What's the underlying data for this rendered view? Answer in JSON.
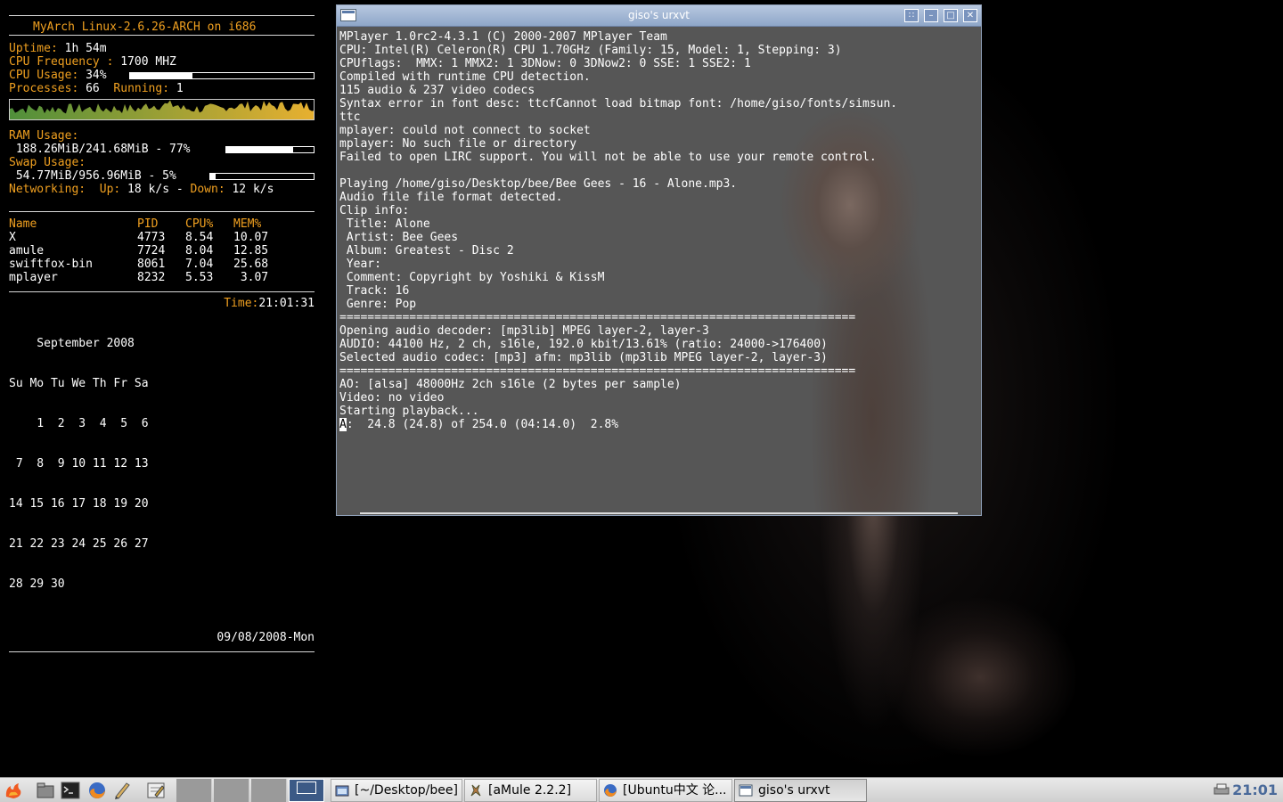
{
  "conky": {
    "header": "MyArch Linux-2.6.26-ARCH on i686",
    "uptime_label": "Uptime:",
    "uptime_value": " 1h 54m",
    "cpu_freq_label": "CPU Frequency :",
    "cpu_freq_value": " 1700 MHZ",
    "cpu_usage_label": "CPU Usage:",
    "cpu_usage_value": " 34%",
    "cpu_usage_fraction": 0.34,
    "processes_label": "Processes:",
    "processes_value": " 66  ",
    "running_label": "Running:",
    "running_value": " 1",
    "ram_label": "RAM Usage:",
    "ram_value": " 188.26MiB/241.68MiB - 77%",
    "ram_fraction": 0.77,
    "swap_label": "Swap Usage:",
    "swap_value": " 54.77MiB/956.96MiB - 5%",
    "swap_fraction": 0.05,
    "net_label": "Networking:",
    "net_up_label": "  Up:",
    "net_up_value": " 18 k/s - ",
    "net_down_label": "Down:",
    "net_down_value": " 12 k/s",
    "proc_headers": [
      "Name",
      "PID",
      "CPU%",
      "MEM%"
    ],
    "proc_rows": [
      [
        "X",
        "4773",
        "8.54",
        "10.07"
      ],
      [
        "amule",
        "7724",
        "8.04",
        "12.85"
      ],
      [
        "swiftfox-bin",
        "8061",
        "7.04",
        "25.68"
      ],
      [
        "mplayer",
        "8232",
        "5.53",
        " 3.07"
      ]
    ],
    "time_label": "Time:",
    "time_value": "21:01:31",
    "calendar": [
      "    September 2008",
      "Su Mo Tu We Th Fr Sa",
      "    1  2  3  4  5  6",
      " 7  8  9 10 11 12 13",
      "14 15 16 17 18 19 20",
      "21 22 23 24 25 26 27",
      "28 29 30"
    ],
    "date": "09/08/2008-Mon",
    "colors": {
      "label": "#f0a020",
      "value": "#ffffff",
      "graph_low": "#4f8f3a",
      "graph_high": "#e8b030"
    }
  },
  "terminal": {
    "title": "giso's urxvt",
    "lines": [
      "MPlayer 1.0rc2-4.3.1 (C) 2000-2007 MPlayer Team",
      "CPU: Intel(R) Celeron(R) CPU 1.70GHz (Family: 15, Model: 1, Stepping: 3)",
      "CPUflags:  MMX: 1 MMX2: 1 3DNow: 0 3DNow2: 0 SSE: 1 SSE2: 1",
      "Compiled with runtime CPU detection.",
      "115 audio & 237 video codecs",
      "Syntax error in font desc: ttcfCannot load bitmap font: /home/giso/fonts/simsun.",
      "ttc",
      "mplayer: could not connect to socket",
      "mplayer: No such file or directory",
      "Failed to open LIRC support. You will not be able to use your remote control.",
      "",
      "Playing /home/giso/Desktop/bee/Bee Gees - 16 - Alone.mp3.",
      "Audio file file format detected.",
      "Clip info:",
      " Title: Alone",
      " Artist: Bee Gees",
      " Album: Greatest - Disc 2",
      " Year:",
      " Comment: Copyright by Yoshiki & KissM",
      " Track: 16",
      " Genre: Pop",
      "==========================================================================",
      "Opening audio decoder: [mp3lib] MPEG layer-2, layer-3",
      "AUDIO: 44100 Hz, 2 ch, s16le, 192.0 kbit/13.61% (ratio: 24000->176400)",
      "Selected audio codec: [mp3] afm: mp3lib (mp3lib MPEG layer-2, layer-3)",
      "==========================================================================",
      "AO: [alsa] 48000Hz 2ch s16le (2 bytes per sample)",
      "Video: no video",
      "Starting playback..."
    ],
    "cursor_char": "A",
    "status_line": ":  24.8 (24.8) of 254.0 (04:14.0)  2.8%"
  },
  "taskbar": {
    "tasks": [
      {
        "label": "[~/Desktop/bee]",
        "icon": "folder-icon",
        "active": false
      },
      {
        "label": "[aMule 2.2.2]",
        "icon": "amule-icon",
        "active": false
      },
      {
        "label": "[Ubuntu中文 论...",
        "icon": "browser-icon",
        "active": false
      },
      {
        "label": "giso's urxvt",
        "icon": "terminal-icon",
        "active": true
      }
    ],
    "clock": "21:01",
    "launchers": [
      "menu-icon",
      "file-manager-icon",
      "terminal-icon",
      "firefox-icon",
      "pen-icon",
      "editor-icon"
    ]
  }
}
